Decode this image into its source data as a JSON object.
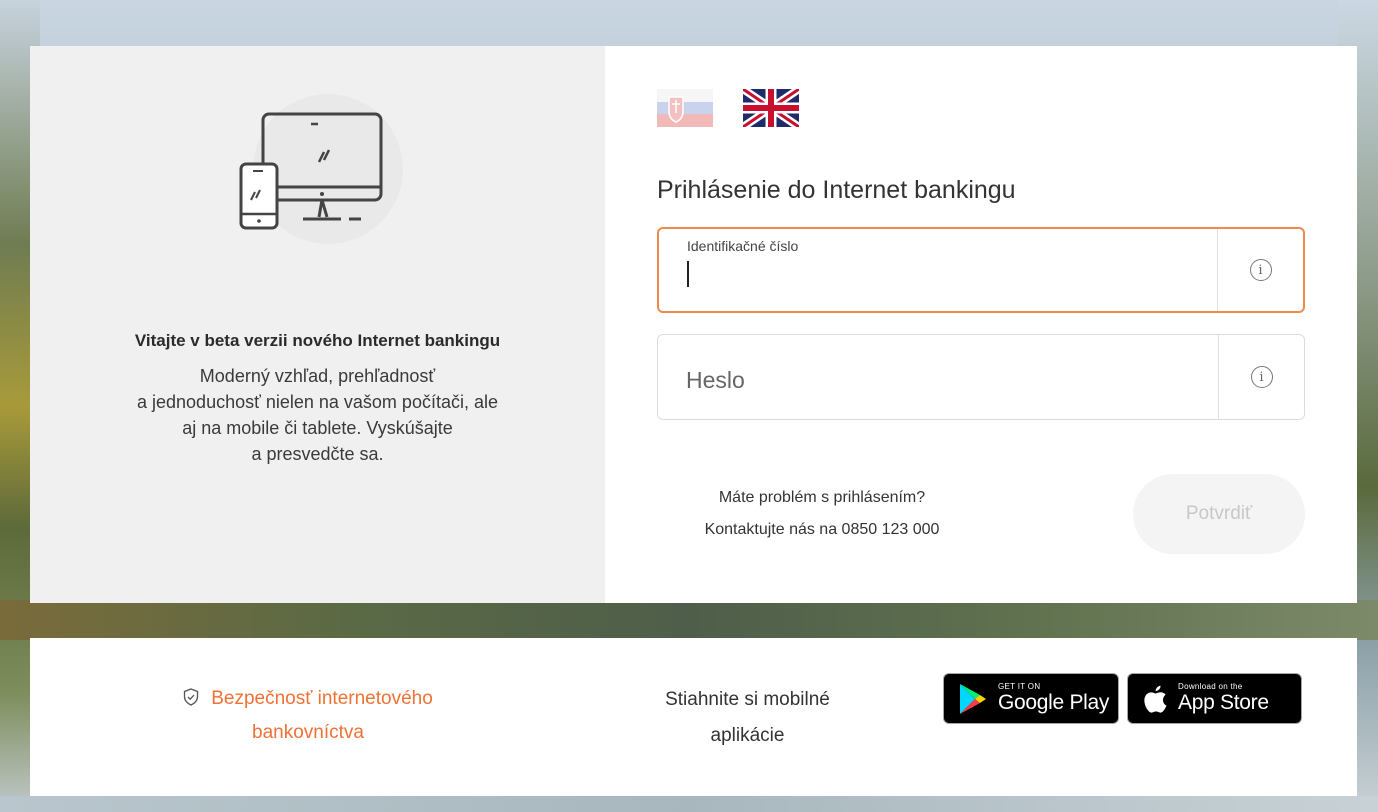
{
  "welcome": {
    "title": "Vitajte v beta verzii nového Internet bankingu",
    "lines": [
      "Moderný vzhľad, prehľadnosť",
      "a jednoduchosť nielen na vašom počítači, ale",
      "aj na mobile či tablete. Vyskúšajte",
      "a presvedčte sa."
    ]
  },
  "languages": [
    {
      "name": "Slovensky",
      "icon": "slovak-flag-icon"
    },
    {
      "name": "English",
      "icon": "uk-flag-icon"
    }
  ],
  "login": {
    "title": "Prihlásenie do Internet bankingu",
    "id_field": {
      "label": "Identifikačné číslo",
      "value": ""
    },
    "password_field": {
      "placeholder": "Heslo",
      "value": ""
    },
    "help_line1": "Máte problém s prihlásením?",
    "help_line2": "Kontaktujte nás na 0850 123 000",
    "confirm_label": "Potvrdiť"
  },
  "footer": {
    "security_line1": "Bezpečnosť internetového",
    "security_line2": "bankovníctva",
    "download_line1": "Stiahnite si mobilné",
    "download_line2": "aplikácie",
    "google_small": "GET IT ON",
    "google_big": "Google Play",
    "apple_small": "Download on the",
    "apple_big": "App Store"
  },
  "colors": {
    "accent": "#f07135",
    "active_border": "#f08a4b",
    "left_panel": "#f0f0f0"
  }
}
